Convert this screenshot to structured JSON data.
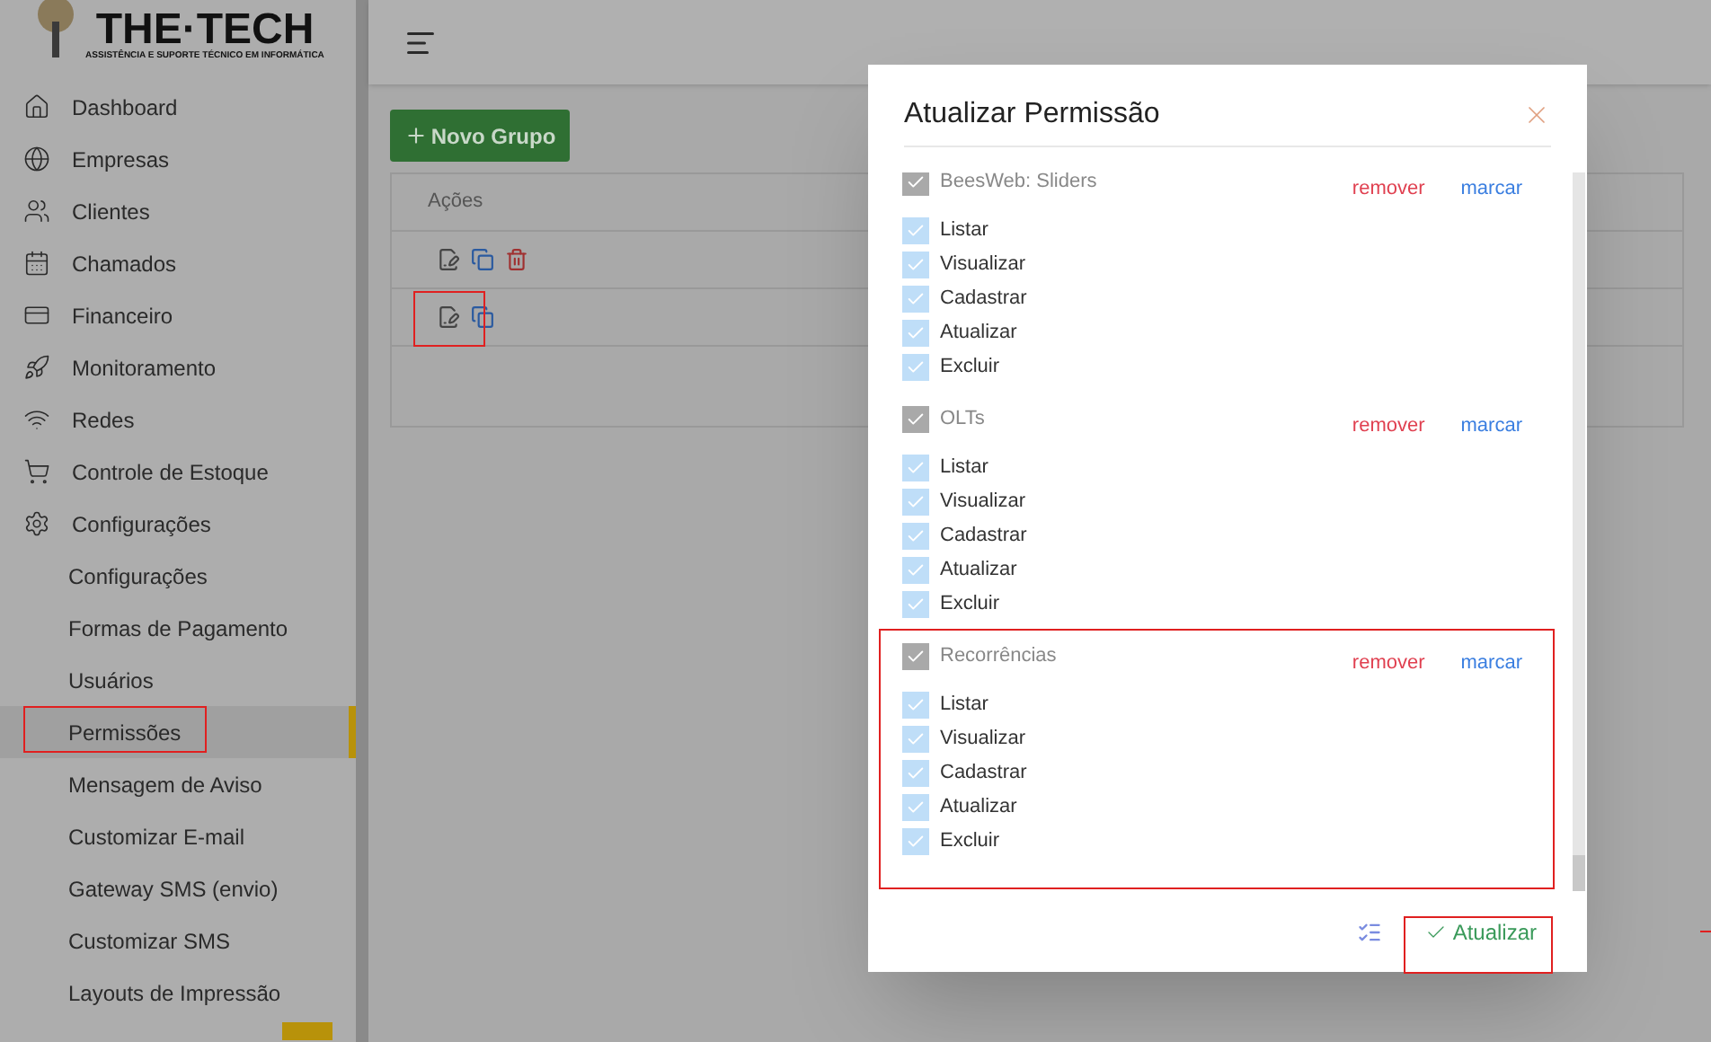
{
  "logo": {
    "name": "THE·TECH",
    "tagline": "ASSISTÊNCIA E SUPORTE TÉCNICO EM INFORMÁTICA"
  },
  "sidebar": {
    "items": [
      {
        "label": "Dashboard",
        "selected": false
      },
      {
        "label": "Empresas",
        "selected": false
      },
      {
        "label": "Clientes",
        "selected": false
      },
      {
        "label": "Chamados",
        "selected": false
      },
      {
        "label": "Financeiro",
        "selected": false
      },
      {
        "label": "Monitoramento",
        "selected": false
      },
      {
        "label": "Redes",
        "selected": false
      },
      {
        "label": "Controle de Estoque",
        "selected": false
      },
      {
        "label": "Configurações",
        "selected": false,
        "children": [
          {
            "label": "Configurações",
            "selected": false
          },
          {
            "label": "Formas de Pagamento",
            "selected": false
          },
          {
            "label": "Usuários",
            "selected": false
          },
          {
            "label": "Permissões",
            "selected": true
          },
          {
            "label": "Mensagem de Aviso",
            "selected": false
          },
          {
            "label": "Customizar E-mail",
            "selected": false
          },
          {
            "label": "Gateway SMS (envio)",
            "selected": false
          },
          {
            "label": "Customizar SMS",
            "selected": false
          },
          {
            "label": "Layouts de Impressão",
            "selected": false
          }
        ]
      }
    ]
  },
  "new_group_button": "Novo Grupo",
  "table": {
    "columns": [
      "Ações"
    ],
    "rows": [
      {
        "deletable": true
      },
      {
        "deletable": false
      }
    ]
  },
  "modal": {
    "title": "Atualizar Permissão",
    "groups": [
      {
        "name": "BeesWeb: Sliders",
        "checked": true,
        "remove": "remover",
        "mark": "marcar",
        "permissions": [
          {
            "label": "Listar",
            "checked": true
          },
          {
            "label": "Visualizar",
            "checked": true
          },
          {
            "label": "Cadastrar",
            "checked": true
          },
          {
            "label": "Atualizar",
            "checked": true
          },
          {
            "label": "Excluir",
            "checked": true
          }
        ]
      },
      {
        "name": "OLTs",
        "checked": true,
        "remove": "remover",
        "mark": "marcar",
        "permissions": [
          {
            "label": "Listar",
            "checked": true
          },
          {
            "label": "Visualizar",
            "checked": true
          },
          {
            "label": "Cadastrar",
            "checked": true
          },
          {
            "label": "Atualizar",
            "checked": true
          },
          {
            "label": "Excluir",
            "checked": true
          }
        ]
      },
      {
        "name": "Recorrências",
        "checked": true,
        "remove": "remover",
        "mark": "marcar",
        "permissions": [
          {
            "label": "Listar",
            "checked": true
          },
          {
            "label": "Visualizar",
            "checked": true
          },
          {
            "label": "Cadastrar",
            "checked": true
          },
          {
            "label": "Atualizar",
            "checked": true
          },
          {
            "label": "Excluir",
            "checked": true
          }
        ]
      }
    ],
    "submit": "Atualizar"
  }
}
